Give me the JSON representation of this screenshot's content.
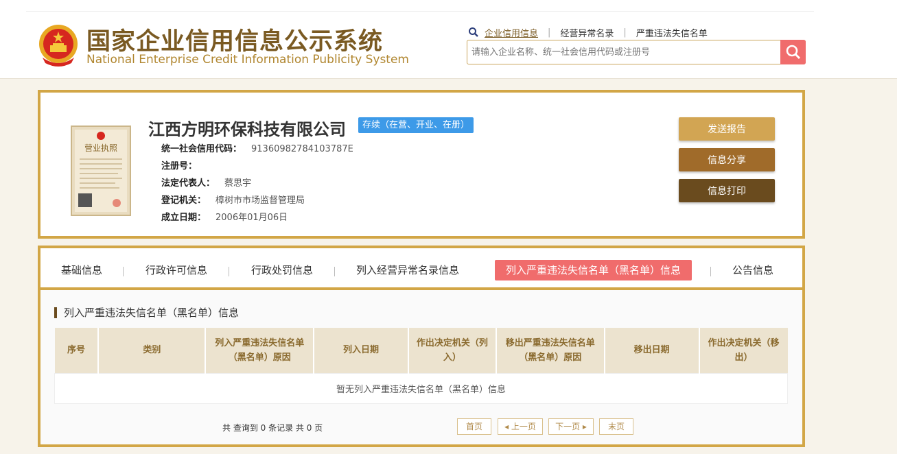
{
  "header": {
    "title_cn": "国家企业信用信息公示系统",
    "title_en": "National Enterprise Credit Information Publicity System",
    "nav": [
      {
        "label": "企业信用信息"
      },
      {
        "label": "经营异常名录"
      },
      {
        "label": "严重违法失信名单"
      }
    ],
    "nav_sep": "|",
    "search_placeholder": "请输入企业名称、统一社会信用代码或注册号"
  },
  "company": {
    "name": "江西方明环保科技有限公司",
    "status": "存续（在营、开业、在册）",
    "license_text": "营业执照",
    "fields": [
      {
        "label": "统一社会信用代码：",
        "value": "91360982784103787E"
      },
      {
        "label": "注册号：",
        "value": ""
      },
      {
        "label": "法定代表人：",
        "value": "蔡思宇"
      },
      {
        "label": "登记机关：",
        "value": "樟树市市场监督管理局"
      },
      {
        "label": "成立日期：",
        "value": "2006年01月06日"
      }
    ],
    "actions": {
      "report": "发送报告",
      "share": "信息分享",
      "print": "信息打印"
    }
  },
  "tabs": [
    {
      "label": "基础信息"
    },
    {
      "label": "行政许可信息"
    },
    {
      "label": "行政处罚信息"
    },
    {
      "label": "列入经营异常名录信息"
    },
    {
      "label": "列入严重违法失信名单（黑名单）信息"
    },
    {
      "label": "公告信息"
    }
  ],
  "section": {
    "title": "列入严重违法失信名单（黑名单）信息",
    "columns": [
      "序号",
      "类别",
      "列入严重违法失信名单（黑名单）原因",
      "列入日期",
      "作出决定机关（列入）",
      "移出严重违法失信名单（黑名单）原因",
      "移出日期",
      "作出决定机关（移出）"
    ],
    "empty_text": "暂无列入严重违法失信名单（黑名单）信息"
  },
  "pager": {
    "summary": "共 查询到 0 条记录 共 0 页",
    "first": "首页",
    "prev": "上一页",
    "next": "下一页",
    "last": "末页"
  },
  "colors": {
    "gold_border": "#d2a646",
    "accent_red": "#f06c6c",
    "badge_blue": "#3d9ae8",
    "btn_report": "#d2a553",
    "btn_share": "#a06b2a",
    "btn_print": "#6a4b1e"
  },
  "icons": [
    "national-emblem-icon",
    "search-icon",
    "magnifier-small-icon",
    "business-license-image"
  ]
}
